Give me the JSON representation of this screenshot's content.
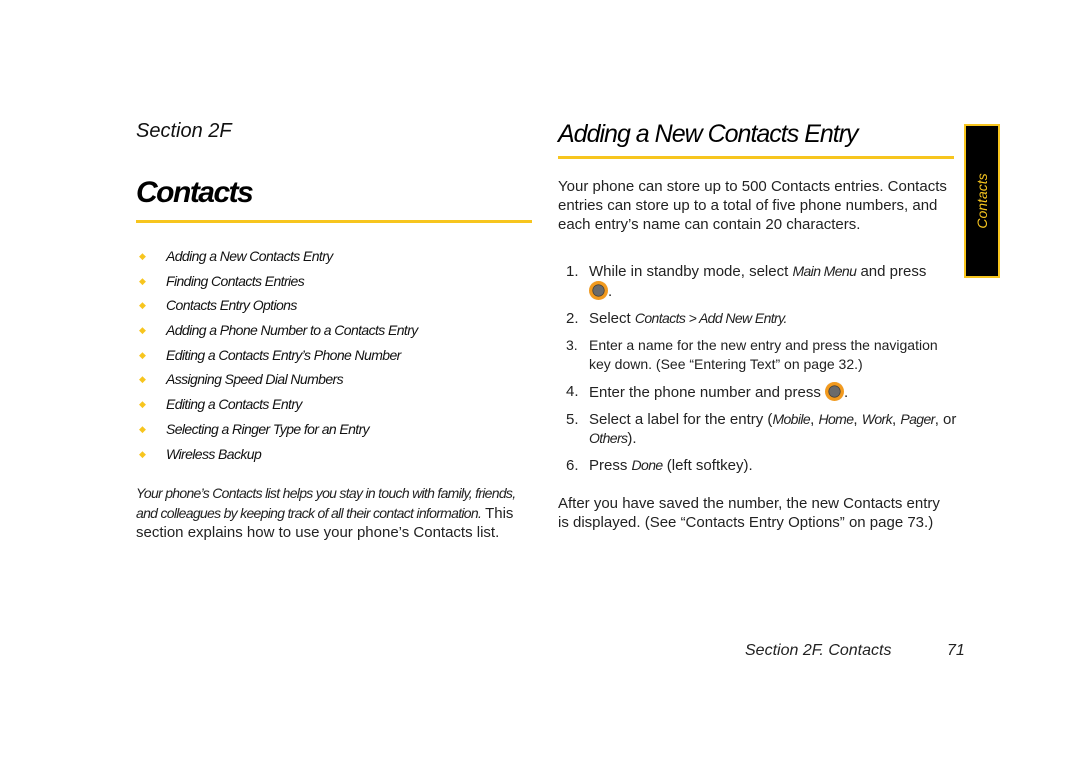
{
  "left": {
    "section_label": "Section 2F",
    "chapter_title": "Contacts",
    "toc_items": [
      "Adding a New Contacts Entry",
      "Finding Contacts Entries",
      "Contacts Entry Options",
      "Adding a Phone Number to a Contacts Entry",
      "Editing a Contacts Entry’s Phone Number",
      "Assigning Speed Dial Numbers",
      "Editing a Contacts Entry",
      "Selecting a Ringer Type for an Entry",
      "Wireless Backup"
    ],
    "bullet": "◆",
    "intro_italic": "Your phone’s Contacts list helps you stay in touch with family, friends, and colleagues by keeping track of all their contact information.",
    "intro_plain": " This section explains how to use your phone’s Contacts list."
  },
  "right": {
    "heading": "Adding a New Contacts Entry",
    "paragraph": "Your phone can store up to 500 Contacts entries. Contacts entries can store up to a total of five phone numbers, and each entry’s name can contain 20 characters.",
    "steps": {
      "s1": {
        "num": "1.",
        "a": "While in standby mode, select ",
        "it": "Main Menu",
        "b": " and press ",
        "end": "."
      },
      "s2": {
        "num": "2.",
        "a": "Select ",
        "it": "Contacts > Add New Entry."
      },
      "s3": {
        "num": "3.",
        "a": "Enter a name for the new entry and press the navigation key down. (See “Entering Text” on page 32.)"
      },
      "s4": {
        "num": "4.",
        "a": "Enter the phone number and press ",
        "end": "."
      },
      "s5": {
        "num": "5.",
        "a": "Select a label for the entry (",
        "i1": "Mobile",
        "c1": ", ",
        "i2": "Home",
        "c2": ", ",
        "i3": "Work",
        "c3": ", ",
        "i4": "Pager",
        "c4": ", or ",
        "i5": "Others",
        "end": ")."
      },
      "s6": {
        "num": "6.",
        "a": "Press ",
        "it": "Done",
        "b": " (left softkey)."
      }
    },
    "after": "After you have saved the number, the new Contacts entry is displayed. (See “Contacts Entry Options” on page 73.)"
  },
  "side_tab": "Contacts",
  "footer": {
    "text": "Section 2F. Contacts",
    "page": "71"
  },
  "colors": {
    "accent": "#f7c51e"
  }
}
